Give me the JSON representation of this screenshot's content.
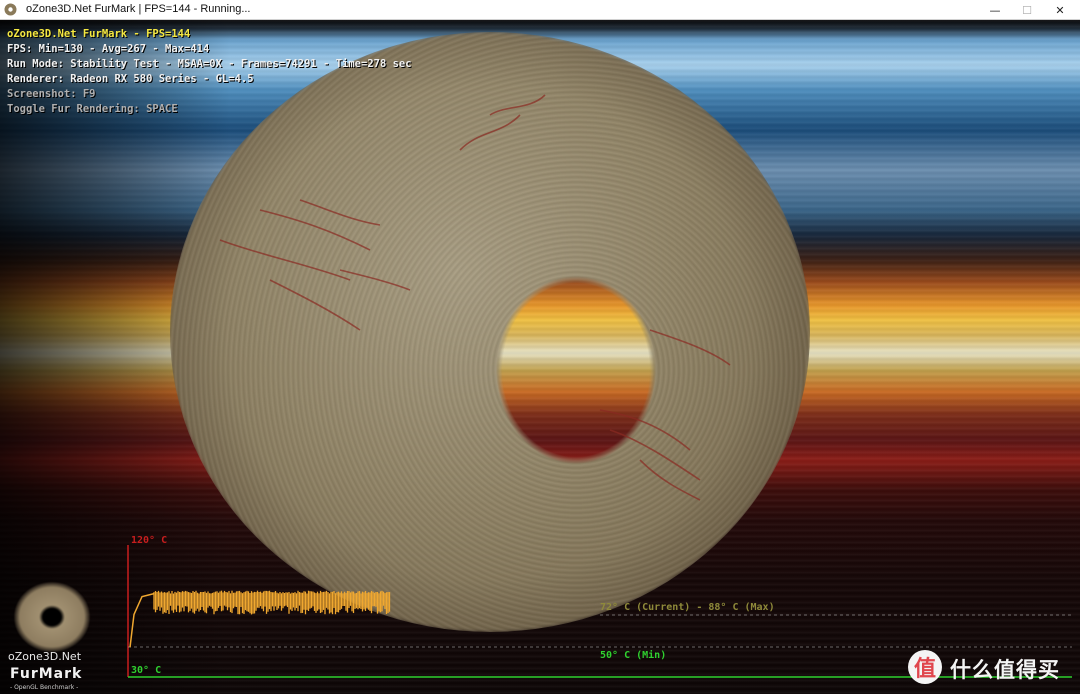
{
  "window": {
    "title": "oZone3D.Net FurMark | FPS=144 - Running...",
    "controls": {
      "minimize": "—",
      "maximize": "☐",
      "close": "✕"
    }
  },
  "overlay": {
    "headline": "oZone3D.Net FurMark - FPS=144",
    "fps": "FPS: Min=130 - Avg=267 - Max=414",
    "run_mode": "Run Mode: Stability Test - MSAA=0X - Frames=74291 - Time=278 sec",
    "renderer": "Renderer: Radeon RX 580 Series - GL=4.5",
    "screenshot": "Screenshot: F9",
    "toggle": "Toggle Fur Rendering: SPACE"
  },
  "temperature_graph": {
    "max_label": "120° C",
    "min_label": "30° C",
    "current_label": "72° C (Current) - 88° C (Max)",
    "min_line_label": "50° C (Min)",
    "scale_max": 120,
    "scale_min": 30,
    "current": 72,
    "max": 88,
    "min": 50,
    "colors": {
      "trace": "#f0a830",
      "axis": "#c81e1e",
      "base": "#2fd12f",
      "current_text": "#8f8a3a",
      "min_text": "#2fd12f"
    }
  },
  "logo": {
    "line1": "oZone3D.Net",
    "line2": "FurMark",
    "line3": "- OpenGL Benchmark -"
  },
  "watermark": {
    "badge": "值",
    "text": "什么值得买"
  }
}
